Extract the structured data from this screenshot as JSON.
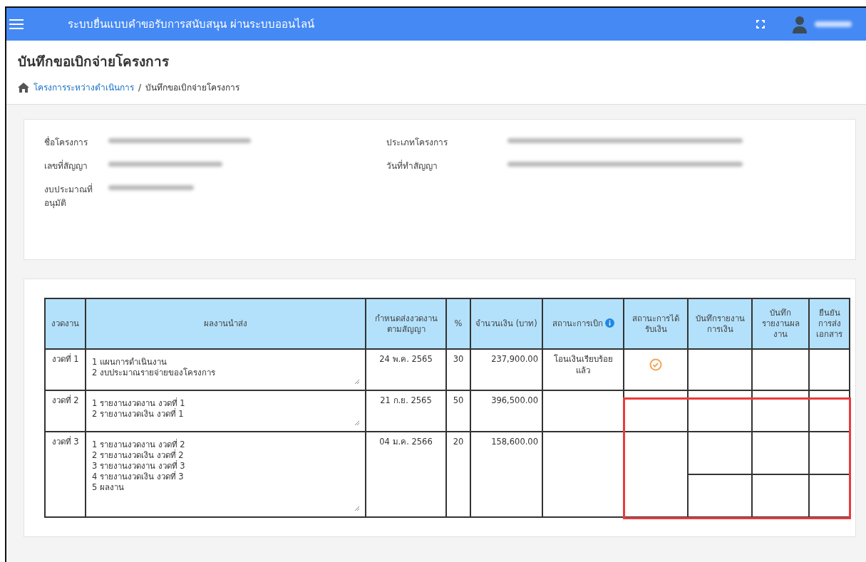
{
  "header": {
    "title": "ระบบยื่นแบบคำขอรับการสนับสนุน ผ่านระบบออนไลน์"
  },
  "page": {
    "title": "บันทึกขอเบิกจ่ายโครงการ",
    "breadcrumb": [
      {
        "label": "โครงการระหว่างดำเนินการ",
        "link": true
      },
      {
        "label": "บันทึกขอเบิกจ่ายโครงการ",
        "link": false
      }
    ],
    "separator": "/"
  },
  "project_info": {
    "fields": [
      {
        "label": "ชื่อโครงการ"
      },
      {
        "label": "ประเภทโครงการ"
      },
      {
        "label": "เลขที่สัญญา"
      },
      {
        "label": "วันที่ทำสัญญา"
      },
      {
        "label": "งบประมาณที่อนุมัติ"
      }
    ]
  },
  "table": {
    "columns": [
      {
        "label": "งวดงาน",
        "info": false
      },
      {
        "label": "ผลงานนำส่ง",
        "info": false
      },
      {
        "label": "กำหนดส่งงวดงานตามสัญญา",
        "info": false
      },
      {
        "label": "%",
        "info": false
      },
      {
        "label": "จำนวนเงิน (บาท)",
        "info": false
      },
      {
        "label": "สถานะการเบิก",
        "info": true
      },
      {
        "label": "สถานะการได้รับเงิน",
        "info": false
      },
      {
        "label": "บันทึกรายงานการเงิน",
        "info": false
      },
      {
        "label": "บันทึกรายงานผลงาน",
        "info": false
      },
      {
        "label": "ยืนยันการส่งเอกสาร",
        "info": false
      }
    ],
    "rows": [
      {
        "installment": "งวดที่ 1",
        "deliverables": [
          "1 แผนการดำเนินงาน",
          "2 งบประมาณรายจ่ายของโครงการ"
        ],
        "due": "24 พ.ค. 2565",
        "percent": "30",
        "amount": "237,900.00",
        "status": "โอนเงินเรียบร้อยแล้ว",
        "received": true,
        "kind": "single"
      },
      {
        "installment": "งวดที่ 2",
        "deliverables": [
          "1 รายงานงวดงาน งวดที่ 1",
          "2 รายงานงวดเงิน งวดที่ 1"
        ],
        "due": "21 ก.ย. 2565",
        "percent": "50",
        "amount": "396,500.00",
        "received": false,
        "kind": "single"
      },
      {
        "installment": "งวดที่ 3",
        "deliverables": [
          "1 รายงานงวดงาน งวดที่ 2",
          "2 รายงานงวดเงิน งวดที่ 2",
          "3 รายงานงวดงาน งวดที่ 3",
          "4 รายงานงวดเงิน งวดที่ 3",
          "5 ผลงาน"
        ],
        "due": "04 ม.ค. 2566",
        "percent": "20",
        "amount": "158,600.00",
        "received": false,
        "kind": "split"
      }
    ]
  }
}
